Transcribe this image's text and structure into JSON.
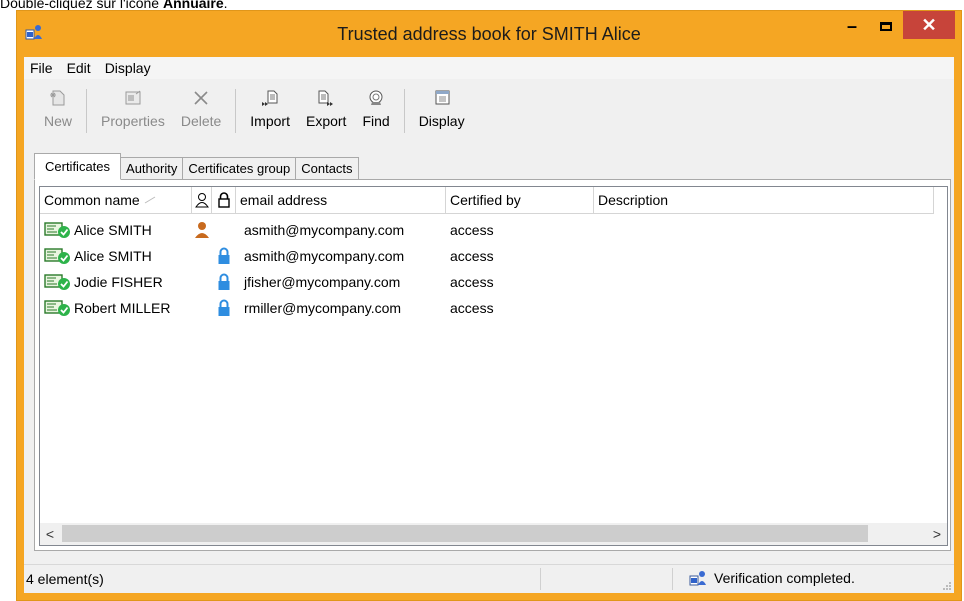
{
  "caption": {
    "prefix": "Double-cliquez sur l'icône ",
    "bold": "Annuaire",
    "suffix": "."
  },
  "window": {
    "title": "Trusted address book for SMITH Alice",
    "minimize": "–",
    "close": "✕"
  },
  "menu": [
    "File",
    "Edit",
    "Display"
  ],
  "toolbar": {
    "new": "New",
    "properties": "Properties",
    "delete": "Delete",
    "import": "Import",
    "export": "Export",
    "find": "Find",
    "display": "Display"
  },
  "tabs": [
    "Certificates",
    "Authority",
    "Certificates group",
    "Contacts"
  ],
  "columns": {
    "common_name": "Common name",
    "email": "email address",
    "certified_by": "Certified by",
    "description": "Description"
  },
  "rows": [
    {
      "name": "Alice SMITH",
      "owner": true,
      "lock": false,
      "email": "asmith@mycompany.com",
      "certified_by": "access",
      "description": ""
    },
    {
      "name": "Alice SMITH",
      "owner": false,
      "lock": true,
      "email": "asmith@mycompany.com",
      "certified_by": "access",
      "description": ""
    },
    {
      "name": "Jodie FISHER",
      "owner": false,
      "lock": true,
      "email": "jfisher@mycompany.com",
      "certified_by": "access",
      "description": ""
    },
    {
      "name": "Robert MILLER",
      "owner": false,
      "lock": true,
      "email": "rmiller@mycompany.com",
      "certified_by": "access",
      "description": ""
    }
  ],
  "scroll": {
    "left": "<",
    "right": ">"
  },
  "status": {
    "count": "4 element(s)",
    "message": "Verification completed."
  },
  "colors": {
    "frame": "#f5a623",
    "close": "#c7443a",
    "cert_green": "#2db34a",
    "owner_icon": "#c86a1e",
    "lock_icon": "#2e8de0"
  }
}
